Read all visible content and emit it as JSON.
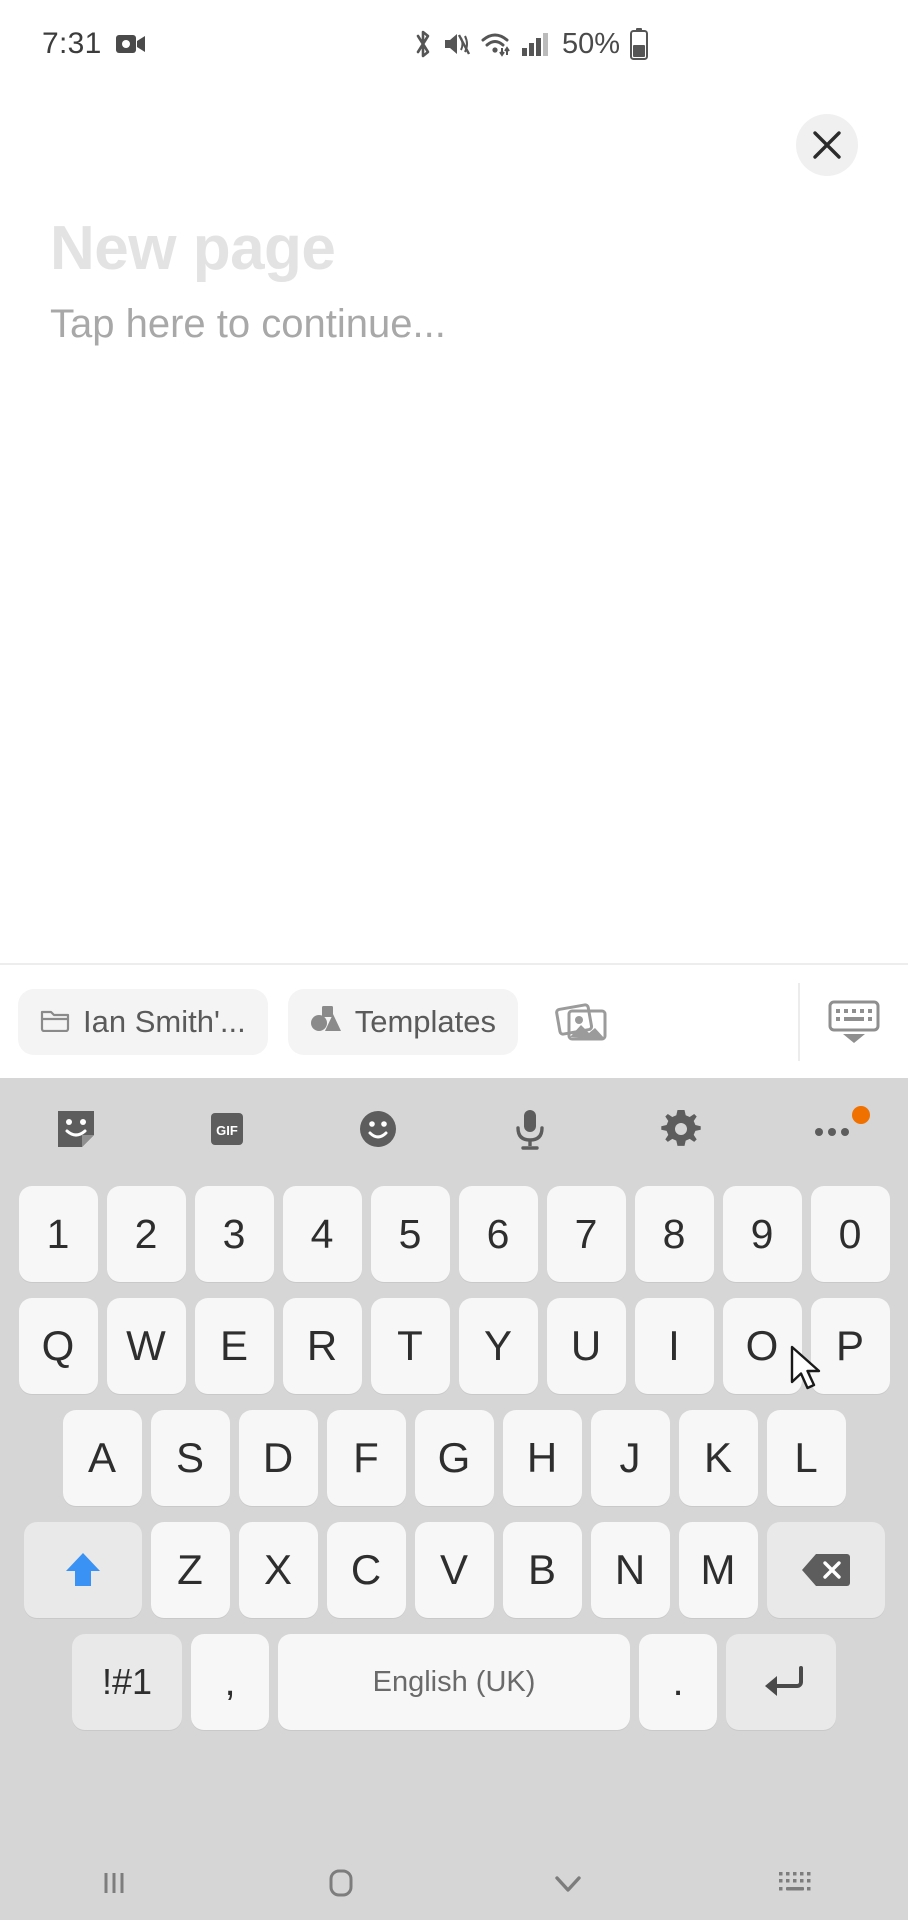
{
  "status_bar": {
    "time": "7:31",
    "battery_percent": "50%",
    "icons": [
      "screen-record-icon",
      "bluetooth-icon",
      "mute-icon",
      "wifi-icon",
      "cellular-signal-icon",
      "battery-icon"
    ]
  },
  "page": {
    "title": "New page",
    "subtitle": "Tap here to continue...",
    "close_label": "close-icon"
  },
  "toolbar": {
    "folder_chip": "Ian Smith'...",
    "templates_chip": "Templates",
    "gallery_icon": "gallery-icon",
    "hide_keyboard_icon": "keyboard-hide-icon"
  },
  "keyboard": {
    "toolbar_icons": [
      "sticker-icon",
      "gif-icon",
      "emoji-icon",
      "microphone-icon",
      "settings-gear-icon",
      "more-options-icon"
    ],
    "gif_label": "GIF",
    "row_numbers": [
      "1",
      "2",
      "3",
      "4",
      "5",
      "6",
      "7",
      "8",
      "9",
      "0"
    ],
    "row_top": [
      "Q",
      "W",
      "E",
      "R",
      "T",
      "Y",
      "U",
      "I",
      "O",
      "P"
    ],
    "row_home": [
      "A",
      "S",
      "D",
      "F",
      "G",
      "H",
      "J",
      "K",
      "L"
    ],
    "row_bottom": [
      "Z",
      "X",
      "C",
      "V",
      "B",
      "N",
      "M"
    ],
    "shift_label": "shift-icon",
    "backspace_label": "backspace-icon",
    "symbols_label": "!#1",
    "comma_label": ",",
    "space_label": "English (UK)",
    "period_label": ".",
    "enter_label": "enter-icon",
    "shift_active_color": "#3b92f5",
    "badge_color": "#f07000"
  },
  "nav_bar": {
    "recents_icon": "recents-icon",
    "home_icon": "home-icon",
    "back_icon": "chevron-down-icon",
    "keyboard_switch_icon": "keyboard-switch-icon"
  }
}
